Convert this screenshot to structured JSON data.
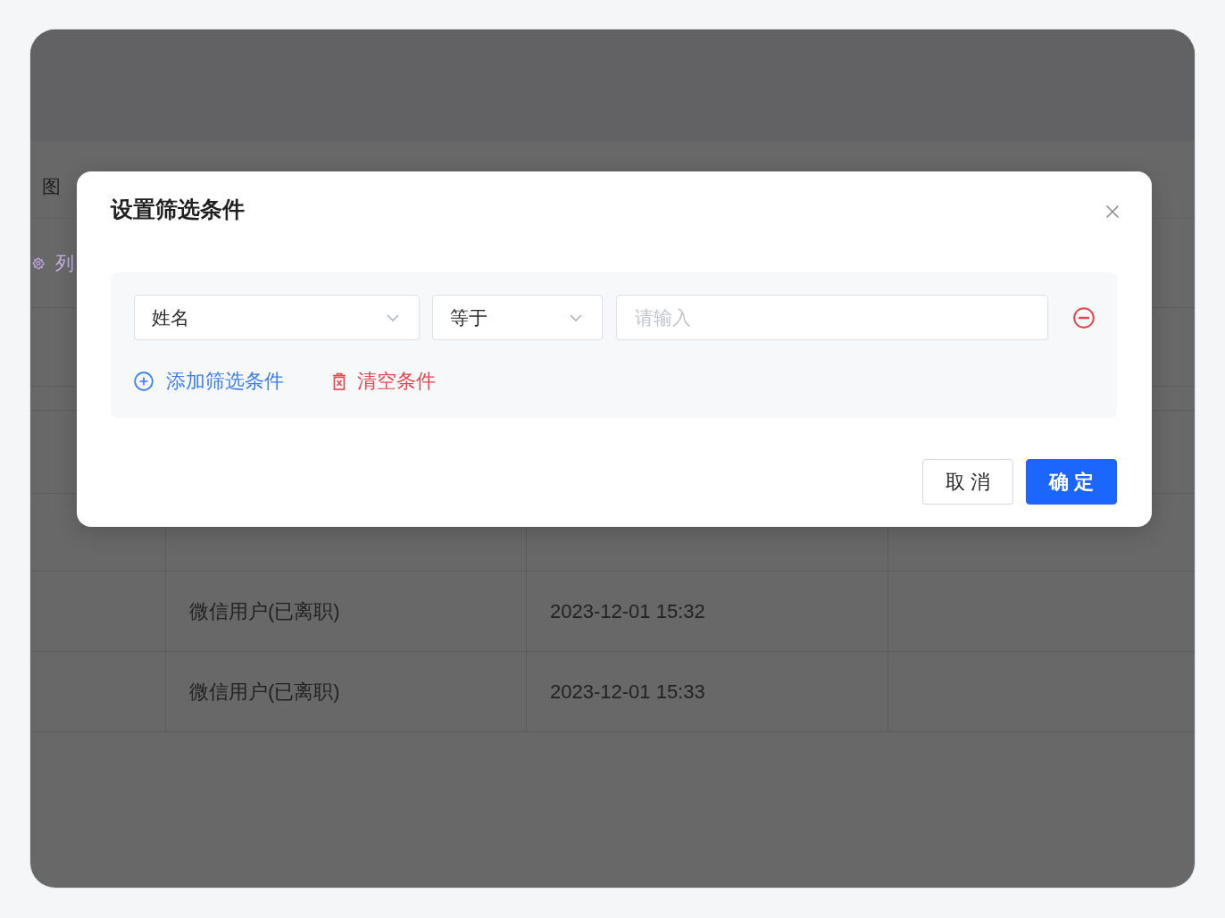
{
  "background": {
    "view_tab": "图",
    "column_button": "列",
    "table": {
      "rows": [
        {
          "cells": [
            "微信用户(已离职)",
            "2023-12-01 15:32"
          ]
        },
        {
          "cells": [
            "微信用户(已离职)",
            "2023-12-01 15:33"
          ]
        }
      ]
    }
  },
  "dialog": {
    "title": "设置筛选条件",
    "conditions": [
      {
        "field": "姓名",
        "operator": "等于",
        "value_placeholder": "请输入"
      }
    ],
    "actions": [
      {
        "kind": "add",
        "label": "添加筛选条件"
      },
      {
        "kind": "clear",
        "label": "清空条件"
      }
    ],
    "buttons": [
      {
        "kind": "default",
        "label": "取 消"
      },
      {
        "kind": "primary",
        "label": "确 定"
      }
    ]
  }
}
